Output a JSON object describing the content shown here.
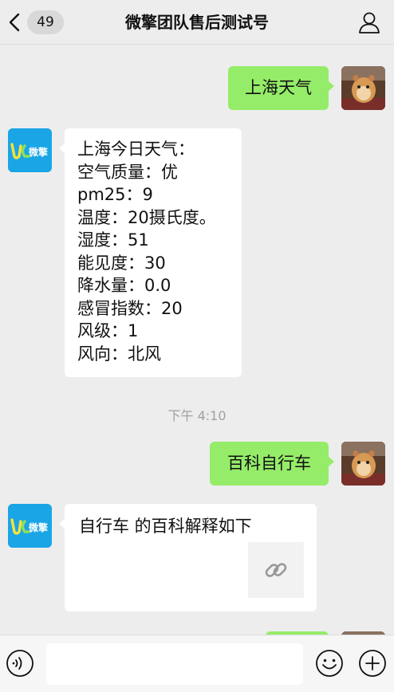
{
  "header": {
    "back_count": "49",
    "title": "微擎团队售后测试号"
  },
  "messages": {
    "user_1": "上海天气",
    "weather_lines": [
      "上海今日天气：",
      "空气质量：优",
      "pm25：9",
      "温度：20摄氏度。",
      "湿度：51",
      "能见度：30",
      "降水量：0.0",
      "感冒指数：20",
      "风级：1",
      "风向：北风"
    ],
    "timestamp": "下午 4:10",
    "user_2": "百科自行车",
    "bot_2": "自行车 的百科解释如下"
  },
  "bot_logo_text": "微擎",
  "input": {
    "value": "",
    "placeholder": ""
  },
  "icons": {
    "back": "chevron-left-icon",
    "profile": "person-icon",
    "voice": "voice-icon",
    "emoji": "emoji-icon",
    "plus": "plus-icon",
    "link": "link-icon"
  },
  "colors": {
    "sent_bubble": "#95ec69",
    "received_bubble": "#ffffff",
    "background": "#ededed",
    "bot_avatar": "#1aa5e6"
  }
}
